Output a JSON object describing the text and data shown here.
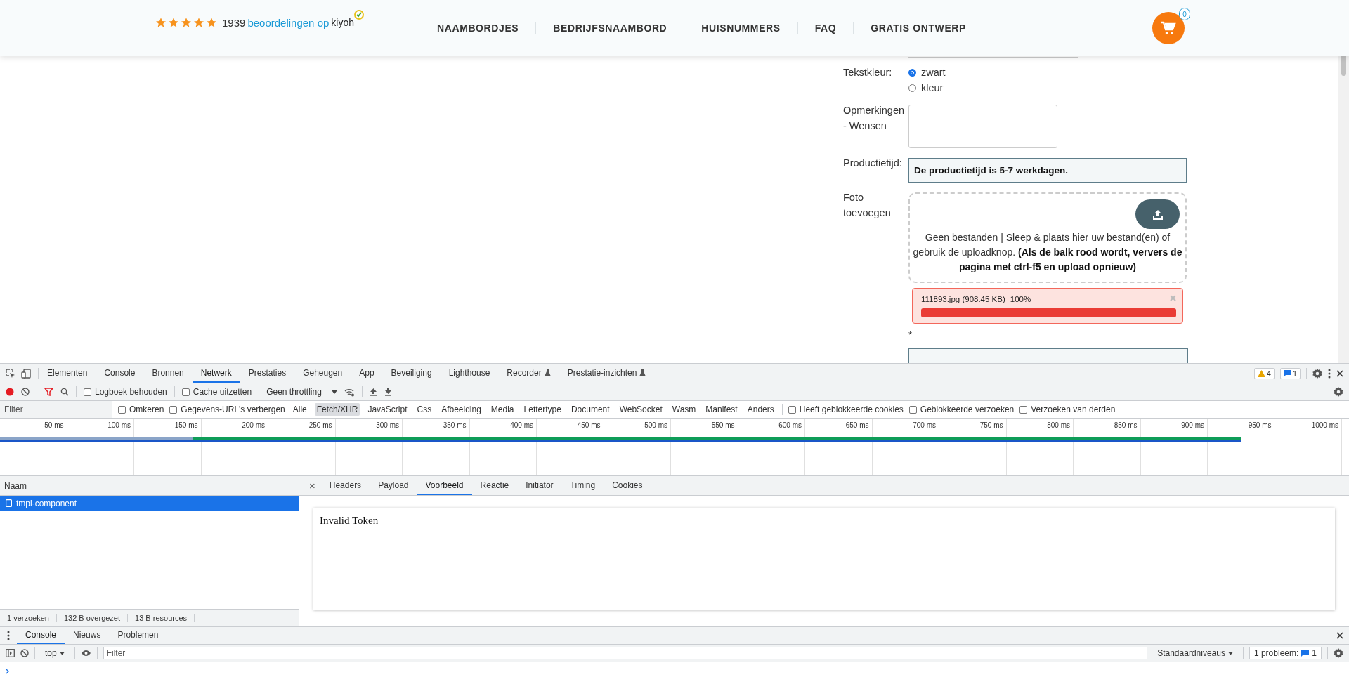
{
  "header": {
    "stars": 5,
    "review_count": "1939",
    "review_link": "beoordelingen op",
    "brand": "kiyoh",
    "nav": [
      "NAAMBORDJES",
      "BEDRIJFSNAAMBORD",
      "HUISNUMMERS",
      "FAQ",
      "GRATIS ONTWERP"
    ],
    "cart_count": "0"
  },
  "form": {
    "text_color": {
      "label": "Tekstkleur:",
      "options": [
        {
          "label": "zwart",
          "selected": true
        },
        {
          "label": "kleur",
          "selected": false
        }
      ]
    },
    "remarks": {
      "label": "Opmerkingen - Wensen"
    },
    "production": {
      "label": "Productietijd:",
      "value": "De productietijd is 5-7 werkdagen."
    },
    "photo": {
      "label": "Foto toevoegen",
      "hint": "Geen bestanden | Sleep & plaats hier uw bestand(en) of gebruik de uploadknop. **(Als de balk rood wordt, ververs de pagina met ctrl-f5 en upload opnieuw)**",
      "file": {
        "name": "111893.jpg (908.45 KB)",
        "percent": "100%",
        "level": 1,
        "failed": true
      },
      "required_mark": "*"
    }
  },
  "devtools": {
    "tabs": [
      {
        "label": "Elementen",
        "selected": false,
        "experimental": false
      },
      {
        "label": "Console",
        "selected": false,
        "experimental": false
      },
      {
        "label": "Bronnen",
        "selected": false,
        "experimental": false
      },
      {
        "label": "Netwerk",
        "selected": true,
        "experimental": false
      },
      {
        "label": "Prestaties",
        "selected": false,
        "experimental": false
      },
      {
        "label": "Geheugen",
        "selected": false,
        "experimental": false
      },
      {
        "label": "App",
        "selected": false,
        "experimental": false
      },
      {
        "label": "Beveiliging",
        "selected": false,
        "experimental": false
      },
      {
        "label": "Lighthouse",
        "selected": false,
        "experimental": false
      },
      {
        "label": "Recorder",
        "selected": false,
        "experimental": true
      },
      {
        "label": "Prestatie-inzichten",
        "selected": false,
        "experimental": true
      }
    ],
    "warnings": "4",
    "messages": "1",
    "toolbar": {
      "recording": true,
      "options": [
        {
          "label": "Logboek behouden",
          "checked": false
        },
        {
          "label": "Cache uitzetten",
          "checked": false
        }
      ],
      "throttling": "Geen throttling"
    },
    "filter": {
      "placeholder": "Filter",
      "options_left": [
        {
          "label": "Omkeren",
          "checked": false
        },
        {
          "label": "Gegevens-URL's verbergen",
          "checked": false
        }
      ],
      "types": [
        {
          "label": "Alle",
          "selected": false
        },
        {
          "label": "Fetch/XHR",
          "selected": true
        },
        {
          "label": "JavaScript",
          "selected": false
        },
        {
          "label": "Css",
          "selected": false
        },
        {
          "label": "Afbeelding",
          "selected": false
        },
        {
          "label": "Media",
          "selected": false
        },
        {
          "label": "Lettertype",
          "selected": false
        },
        {
          "label": "Document",
          "selected": false
        },
        {
          "label": "WebSocket",
          "selected": false
        },
        {
          "label": "Wasm",
          "selected": false
        },
        {
          "label": "Manifest",
          "selected": false
        },
        {
          "label": "Anders",
          "selected": false
        }
      ],
      "options_right": [
        {
          "label": "Heeft geblokkeerde cookies",
          "checked": false
        },
        {
          "label": "Geblokkeerde verzoeken",
          "checked": false
        },
        {
          "label": "Verzoeken van derden",
          "checked": false
        }
      ]
    },
    "timeline": {
      "ticks": [
        "50 ms",
        "100 ms",
        "150 ms",
        "200 ms",
        "250 ms",
        "300 ms",
        "350 ms",
        "400 ms",
        "450 ms",
        "500 ms",
        "550 ms",
        "600 ms",
        "650 ms",
        "700 ms",
        "750 ms",
        "800 ms",
        "850 ms",
        "900 ms",
        "950 ms",
        "1000 ms"
      ]
    },
    "requests": {
      "column": "Naam",
      "rows": [
        {
          "name": "tmpl-component",
          "selected": true
        }
      ]
    },
    "detail": {
      "close": "×",
      "tabs": [
        {
          "label": "Headers",
          "selected": false
        },
        {
          "label": "Payload",
          "selected": false
        },
        {
          "label": "Voorbeeld",
          "selected": true
        },
        {
          "label": "Reactie",
          "selected": false
        },
        {
          "label": "Initiator",
          "selected": false
        },
        {
          "label": "Timing",
          "selected": false
        },
        {
          "label": "Cookies",
          "selected": false
        }
      ],
      "preview": "Invalid Token"
    },
    "status": [
      "1 verzoeken",
      "132 B overgezet",
      "13 B resources"
    ],
    "drawer": {
      "tabs": [
        {
          "label": "Console",
          "selected": true
        },
        {
          "label": "Nieuws",
          "selected": false
        },
        {
          "label": "Problemen",
          "selected": false
        }
      ],
      "context": "top",
      "filter_placeholder": "Filter",
      "levels": "Standaardniveaus",
      "issues_label": "1 probleem:",
      "issues_count": "1"
    }
  }
}
